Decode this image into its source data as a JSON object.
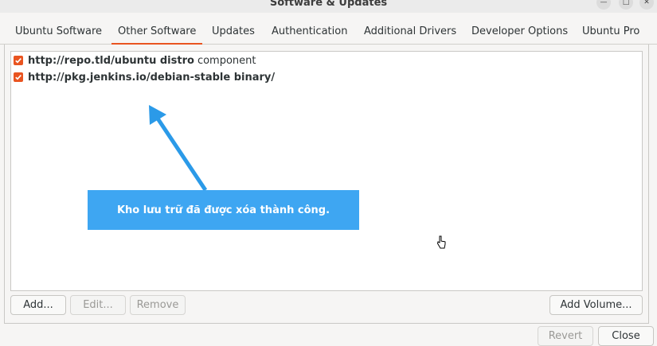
{
  "window": {
    "title": "Software & Updates",
    "controls": {
      "minimize": "—",
      "maximize": "□",
      "close": "✕"
    }
  },
  "tabs": [
    {
      "label": "Ubuntu Software"
    },
    {
      "label": "Other Software",
      "active": true
    },
    {
      "label": "Updates"
    },
    {
      "label": "Authentication"
    },
    {
      "label": "Additional Drivers"
    },
    {
      "label": "Developer Options"
    },
    {
      "label": "Ubuntu Pro"
    }
  ],
  "sources": [
    {
      "checked": true,
      "bold": "http://repo.tld/ubuntu distro",
      "rest": "component"
    },
    {
      "checked": true,
      "bold": "http://pkg.jenkins.io/debian-stable binary/",
      "rest": ""
    }
  ],
  "toast": {
    "message": "Kho lưu trữ đã được xóa thành công."
  },
  "buttons": {
    "add": "Add...",
    "edit": "Edit...",
    "remove": "Remove",
    "add_volume": "Add Volume...",
    "revert": "Revert",
    "close": "Close"
  },
  "colors": {
    "accent": "#e95420",
    "toast": "#3ea6f2"
  }
}
